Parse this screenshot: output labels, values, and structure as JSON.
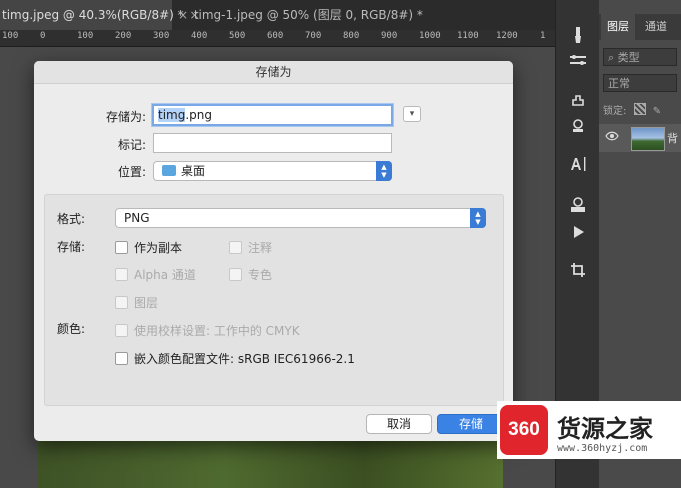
{
  "tabs": [
    {
      "label": "timg.jpeg @ 40.3%(RGB/8#) *"
    },
    {
      "label": "timg-1.jpeg @ 50% (图层 0, RGB/8#) *"
    }
  ],
  "tab_close_glyph": "×",
  "ruler_ticks": [
    "100",
    "0",
    "100",
    "200",
    "300",
    "400",
    "500",
    "600",
    "700",
    "800",
    "900",
    "1000",
    "1100",
    "1200",
    "1"
  ],
  "tools": [
    "brush-icon",
    "path-icon",
    "puppet-icon",
    "stamp-icon",
    "text-icon",
    "3d-icon",
    "play-icon",
    "crop-icon"
  ],
  "layers_panel": {
    "tab_layers": "图层",
    "tab_channels": "通道",
    "filter_kind": "类型",
    "blend_mode": "正常",
    "lock_label": "锁定:",
    "layer_name": "背"
  },
  "dialog": {
    "title": "存储为",
    "save_as_label": "存储为:",
    "filename": {
      "selected": "timg",
      "rest": ".png"
    },
    "tags_label": "标记:",
    "tags_value": "",
    "location_label": "位置:",
    "location_value": "桌面",
    "format_label": "格式:",
    "format_value": "PNG",
    "save_label": "存储:",
    "color_label": "颜色:",
    "options": {
      "as_copy": "作为副本",
      "notes": "注释",
      "alpha": "Alpha 通道",
      "spot": "专色",
      "layers": "图层",
      "proof": "使用校样设置: 工作中的 CMYK",
      "embed": "嵌入颜色配置文件: sRGB IEC61966-2.1"
    },
    "cancel_button": "取消",
    "save_button": "存储"
  },
  "watermark": {
    "badge": "360",
    "brand": "货源之家",
    "url": "www.360hyzj.com"
  },
  "colors": {
    "accent": "#3b82e5",
    "badge": "#e0252c"
  }
}
